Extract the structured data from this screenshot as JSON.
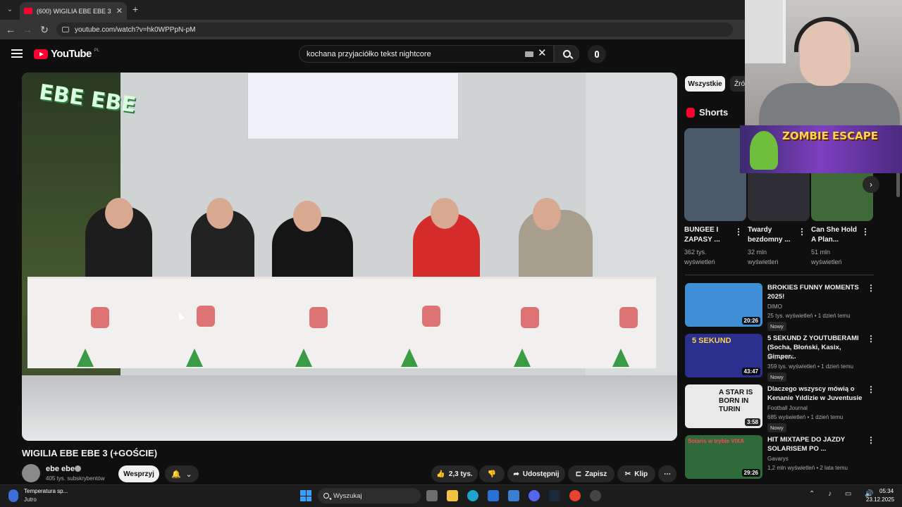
{
  "browser": {
    "tab_title": "(600) WIGILIA EBE EBE 3 (+GOŚC",
    "tab_close": "✕",
    "new_tab": "+",
    "url": "youtube.com/watch?v=hk0WPPpN-pM",
    "back": "←",
    "forward": "→",
    "reload": "↻",
    "tab_menu": "⌄"
  },
  "header": {
    "logo_text": "YouTube",
    "country": "PL",
    "search_value": "kochana przyjaciółko tekst nightcore",
    "clear": "✕"
  },
  "video": {
    "overlay_logo": "EBE EBE",
    "title": "WIGILIA EBE EBE 3 (+GOŚCIE)"
  },
  "channel": {
    "name": "ebe ebe",
    "subscribers": "405 tys. subskrybentów",
    "support_label": "Wesprzyj",
    "bell": "🔔",
    "chevron": "⌄"
  },
  "actions": {
    "likes": "2,3 tys.",
    "share": "Udostępnij",
    "save": "Zapisz",
    "clip": "Klip",
    "more": "⋯"
  },
  "chips": {
    "all": "Wszystkie",
    "source": "Źró"
  },
  "shorts": {
    "heading": "Shorts",
    "items": [
      {
        "title": "BUNGEE I ZAPASY ...",
        "views": "362 tys. wyświetleń",
        "color": "#4a5a6a"
      },
      {
        "title": "Twardy bezdomny ...",
        "views": "32 mln wyświetleń",
        "color": "#2e2e34"
      },
      {
        "title": "Can She Hold A Plan...",
        "views": "51 mln wyświetleń",
        "color": "#3e6a3a"
      }
    ],
    "next": "›"
  },
  "recommended": [
    {
      "title": "BROKIES FUNNY MOMENTS 2025!",
      "channel": "DIMO",
      "meta": "25 tys. wyświetleń • 1 dzień temu",
      "badge": "Nowy",
      "duration": "20:26",
      "color": "#3f8fd6"
    },
    {
      "title": "5 SEKUND Z YOUTUBERAMI (Socha, Błoński, Kasix, Gimper...",
      "channel": "EKIPA WK",
      "meta": "359 tys. wyświetleń • 1 dzień temu",
      "badge": "Nowy",
      "duration": "43:47",
      "color": "#2b2f8e"
    },
    {
      "title": "Dlaczego wszyscy mówią o Kenanie Yıldizie w Juventusie",
      "channel": "Football Journal",
      "meta": "685 wyświetleń • 1 dzień temu",
      "badge": "Nowy",
      "duration": "3:58",
      "color": "#e9e9e9"
    },
    {
      "title": "HIT MIXTAPE DO JAZDY SOLARISEM PO ...",
      "channel": "Gavarys",
      "meta": "1,2 mln wyświetleń • 2 lata temu",
      "badge": "",
      "duration": "29:26",
      "color": "#2f6a3a"
    }
  ],
  "thumb_texts": {
    "t2": "5 SEKUND",
    "t3": "A STAR IS BORN IN TURIN",
    "t4": "Solaris w trybie VIXA"
  },
  "stream_overlay": {
    "banner": "ZOMBIE ESCAPE"
  },
  "taskbar": {
    "weather_title": "Temperatura sp...",
    "weather_sub": "Jutro",
    "search": "Wyszukaj",
    "time": "05:34",
    "date": "23.12.2025",
    "tray": "⌃ ♪ ▭ 🔊"
  }
}
